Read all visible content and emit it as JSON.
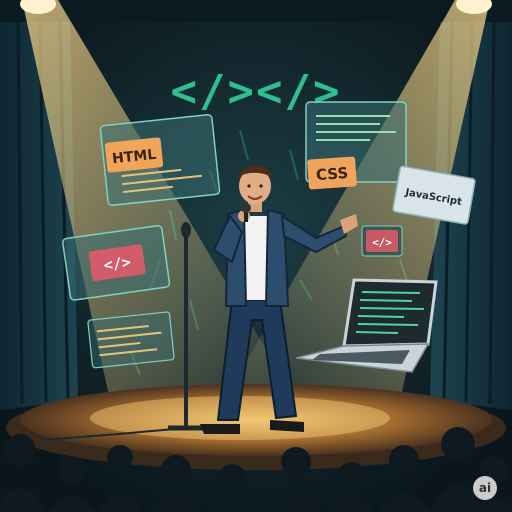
{
  "scene": {
    "top_banner": "</></>",
    "cards": {
      "html": "HTML",
      "css": "CSS",
      "javascript": "JavaScript",
      "tag_left": "</>",
      "tag_right": "</>"
    },
    "badge": "ai"
  },
  "colors": {
    "background": "#0c1a22",
    "curtain": "#16323c",
    "code_green": "#2fbf8f",
    "spotlight": "#f2c66e",
    "stage_floor": "#6b4a2a",
    "html_label": "#f2a45a",
    "css_label": "#f0a35c",
    "tag_pink": "#e05a6a"
  }
}
